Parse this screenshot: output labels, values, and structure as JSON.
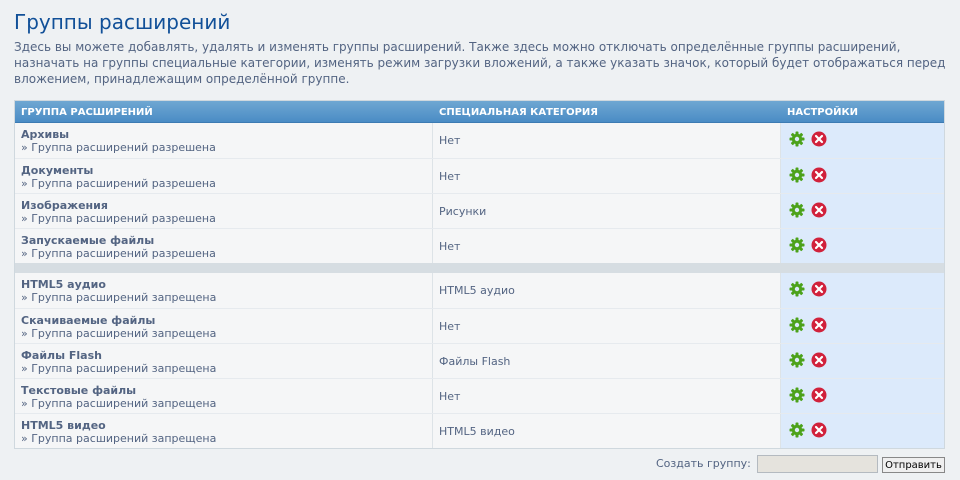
{
  "page": {
    "title": "Группы расширений",
    "description": "Здесь вы можете добавлять, удалять и изменять группы расширений. Также здесь можно отключать определённые группы расширений, назначать на группы специальные категории, изменять режим загрузки вложений, а также указать значок, который будет отображаться перед вложением, принадлежащим определённой группе."
  },
  "table": {
    "headers": [
      "Группа расширений",
      "Специальная категория",
      "Настройки"
    ],
    "allowed": [
      {
        "name": "Архивы",
        "status": "» Группа расширений разрешена",
        "category": "Нет"
      },
      {
        "name": "Документы",
        "status": "» Группа расширений разрешена",
        "category": "Нет"
      },
      {
        "name": "Изображения",
        "status": "» Группа расширений разрешена",
        "category": "Рисунки"
      },
      {
        "name": "Запускаемые файлы",
        "status": "» Группа расширений разрешена",
        "category": "Нет"
      }
    ],
    "denied": [
      {
        "name": "HTML5 аудио",
        "status": "» Группа расширений запрещена",
        "category": "HTML5 аудио"
      },
      {
        "name": "Скачиваемые файлы",
        "status": "» Группа расширений запрещена",
        "category": "Нет"
      },
      {
        "name": "Файлы Flash",
        "status": "» Группа расширений запрещена",
        "category": "Файлы Flash"
      },
      {
        "name": "Текстовые файлы",
        "status": "» Группа расширений запрещена",
        "category": "Нет"
      },
      {
        "name": "HTML5 видео",
        "status": "» Группа расширений запрещена",
        "category": "HTML5 видео"
      }
    ],
    "action_icons": [
      "gear-icon",
      "delete-icon"
    ]
  },
  "footer": {
    "create_label": "Создать группу:",
    "input_value": "",
    "submit_label": "Отправить"
  },
  "colors": {
    "title": "#115098",
    "header": "#4a8cc5",
    "settings_bg": "#dceafb",
    "gear": "#4ca21a",
    "delete": "#d1213b"
  }
}
